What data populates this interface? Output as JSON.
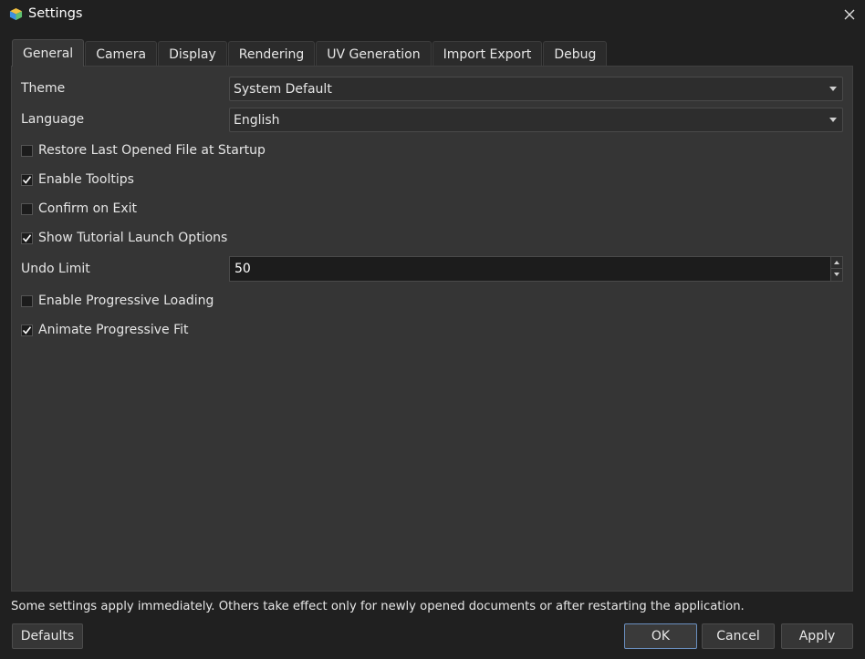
{
  "window": {
    "title": "Settings",
    "app_icon": "cube-icon",
    "close_icon": "close-icon"
  },
  "tabs": [
    {
      "label": "General",
      "active": true
    },
    {
      "label": "Camera",
      "active": false
    },
    {
      "label": "Display",
      "active": false
    },
    {
      "label": "Rendering",
      "active": false
    },
    {
      "label": "UV Generation",
      "active": false
    },
    {
      "label": "Import Export",
      "active": false
    },
    {
      "label": "Debug",
      "active": false
    }
  ],
  "general": {
    "theme": {
      "label": "Theme",
      "value": "System Default"
    },
    "language": {
      "label": "Language",
      "value": "English"
    },
    "restore_last": {
      "label": "Restore Last Opened File at Startup",
      "checked": false
    },
    "tooltips": {
      "label": "Enable Tooltips",
      "checked": true
    },
    "confirm_exit": {
      "label": "Confirm on Exit",
      "checked": false
    },
    "tutorial": {
      "label": "Show Tutorial Launch Options",
      "checked": true
    },
    "undo_limit": {
      "label": "Undo Limit",
      "value": "50"
    },
    "progressive_loading": {
      "label": "Enable Progressive Loading",
      "checked": false
    },
    "progressive_fit": {
      "label": "Animate Progressive Fit",
      "checked": true
    }
  },
  "footer": {
    "note": "Some settings apply immediately. Others take effect only for newly opened documents or after restarting the application.",
    "defaults_label": "Defaults",
    "ok_label": "OK",
    "cancel_label": "Cancel",
    "apply_label": "Apply"
  },
  "colors": {
    "background": "#202020",
    "panel": "#353535",
    "primary_border": "#6a8fbf"
  }
}
